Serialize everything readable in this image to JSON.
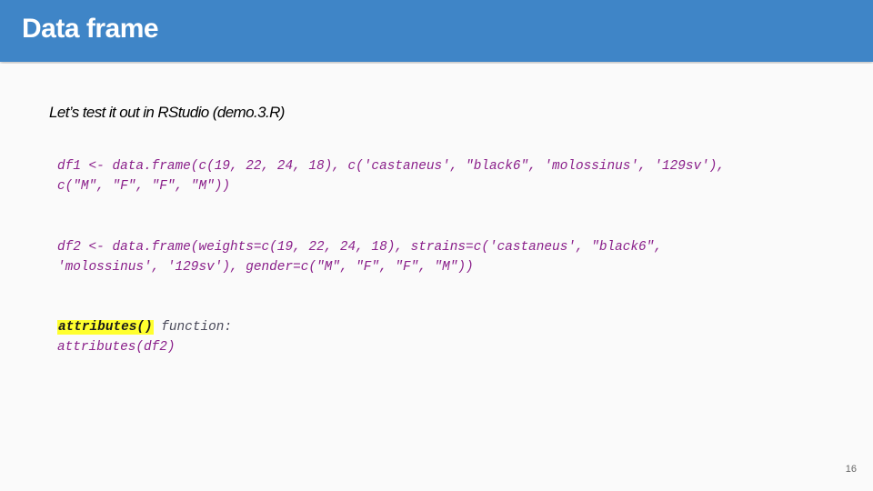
{
  "slide": {
    "title": "Data frame",
    "subtitle": "Let’s test it out in RStudio (demo.3.R)",
    "code_block_1": {
      "line_1": "df1 <- data.frame(c(19, 22, 24, 18), c('castaneus', \"black6\", 'molossinus', '129sv'),",
      "line_2": "c(\"M\", \"F\", \"F\", \"M\"))"
    },
    "code_block_2": {
      "line_1": "df2 <- data.frame(weights=c(19, 22, 24, 18), strains=c('castaneus', \"black6\",",
      "line_2": "'molossinus', '129sv'), gender=c(\"M\", \"F\", \"F\", \"M\"))"
    },
    "code_block_3": {
      "highlight": "attributes()",
      "highlight_suffix": " function:",
      "line_2": "attributes(df2)"
    },
    "page_number": "16"
  },
  "colors": {
    "header": "#3f85c7",
    "code_text": "#8a1f8a",
    "highlight": "#ffff2e"
  }
}
